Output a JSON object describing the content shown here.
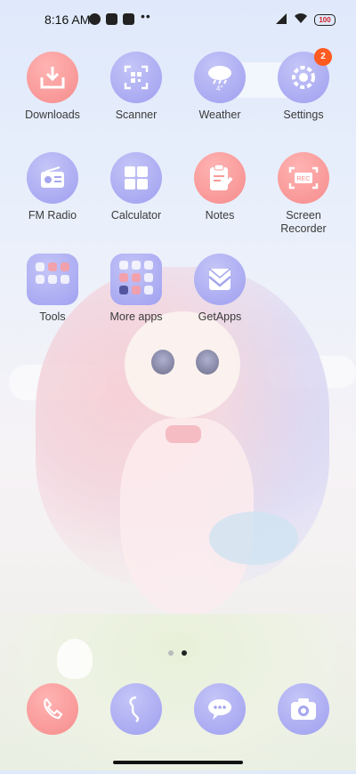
{
  "status_bar": {
    "time": "8:16 AM",
    "dots": "••",
    "battery": "100"
  },
  "apps_row1": [
    {
      "label": "Downloads",
      "icon": "download-tray-icon",
      "color": "pink"
    },
    {
      "label": "Scanner",
      "icon": "qr-scan-icon",
      "color": "purple"
    },
    {
      "label": "Weather",
      "icon": "cloud-rain-icon",
      "color": "purple",
      "weather_text": "4°"
    },
    {
      "label": "Settings",
      "icon": "gear-icon",
      "color": "purple",
      "badge": "2"
    }
  ],
  "apps_row2": [
    {
      "label": "FM Radio",
      "icon": "radio-icon",
      "color": "purple"
    },
    {
      "label": "Calculator",
      "icon": "calculator-icon",
      "color": "purple"
    },
    {
      "label": "Notes",
      "icon": "clipboard-pen-icon",
      "color": "pink"
    },
    {
      "label": "Screen\nRecorder",
      "line1": "Screen",
      "line2": "Recorder",
      "icon": "rec-icon",
      "color": "pink",
      "rec_text": "REC"
    }
  ],
  "apps_row3": [
    {
      "label": "Tools",
      "icon": "folder-icon"
    },
    {
      "label": "More apps",
      "icon": "folder-icon"
    },
    {
      "label": "GetApps",
      "icon": "getapps-icon",
      "color": "purple"
    }
  ],
  "dock": [
    {
      "icon": "phone-icon",
      "color": "pink"
    },
    {
      "icon": "messages-icon",
      "color": "purple"
    },
    {
      "icon": "chat-bubbles-icon",
      "color": "purple"
    },
    {
      "icon": "camera-icon",
      "color": "purple"
    }
  ]
}
